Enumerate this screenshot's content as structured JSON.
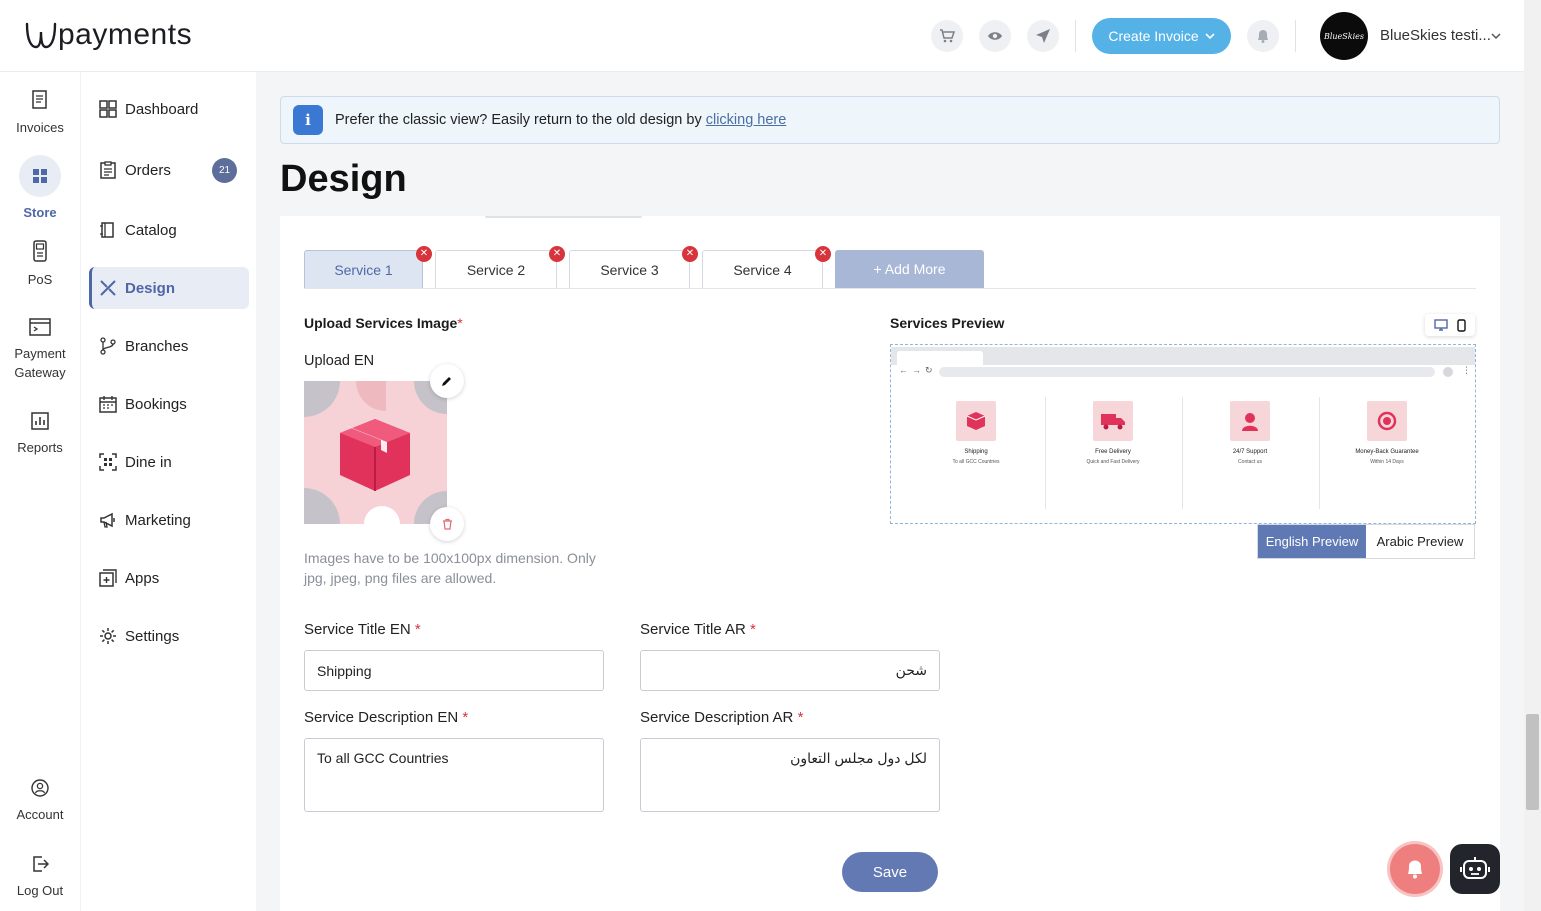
{
  "header": {
    "logo_text": "payments",
    "create_invoice_label": "Create Invoice",
    "avatar_text": "BlueSkies",
    "account_name": "BlueSkies testi..."
  },
  "rail": {
    "items": [
      {
        "label": "Invoices"
      },
      {
        "label": "Store"
      },
      {
        "label": "PoS"
      },
      {
        "label": "Payment Gateway"
      },
      {
        "label": "Reports"
      },
      {
        "label": "Account"
      },
      {
        "label": "Log Out"
      }
    ]
  },
  "sidebar": {
    "items": [
      {
        "label": "Dashboard"
      },
      {
        "label": "Orders",
        "badge": "21"
      },
      {
        "label": "Catalog"
      },
      {
        "label": "Design"
      },
      {
        "label": "Branches"
      },
      {
        "label": "Bookings"
      },
      {
        "label": "Dine in"
      },
      {
        "label": "Marketing"
      },
      {
        "label": "Apps"
      },
      {
        "label": "Settings"
      }
    ]
  },
  "banner": {
    "text": "Prefer the classic view? Easily return to the old design by ",
    "link": "clicking here",
    "icon": "i"
  },
  "page_title": "Design",
  "tabs": [
    {
      "label": "Service 1",
      "active": true
    },
    {
      "label": "Service 2"
    },
    {
      "label": "Service 3"
    },
    {
      "label": "Service 4"
    }
  ],
  "add_more_label": "+ Add More",
  "upload": {
    "section_label": "Upload Services Image",
    "required_mark": "*",
    "upload_en_label": "Upload EN",
    "hint": "Images have to be 100x100px dimension. Only jpg, jpeg, png files are allowed."
  },
  "preview": {
    "section_label": "Services Preview",
    "items": [
      {
        "title": "Shipping",
        "desc": "To all GCC Countries"
      },
      {
        "title": "Free Delivery",
        "desc": "Quick and Fast Delivery"
      },
      {
        "title": "24/7 Support",
        "desc": "Contact us"
      },
      {
        "title": "Money-Back Guarantee",
        "desc": "Within 14 Days"
      }
    ],
    "english_label": "English Preview",
    "arabic_label": "Arabic Preview"
  },
  "form": {
    "title_en_label": "Service Title EN",
    "title_en_value": "Shipping",
    "title_ar_label": "Service Title AR",
    "title_ar_value": "شحن",
    "desc_en_label": "Service Description EN",
    "desc_en_value": "To all GCC Countries",
    "desc_ar_label": "Service Description AR",
    "desc_ar_value": "لكل دول مجلس التعاون",
    "required_mark": "*"
  },
  "save_label": "Save",
  "colors": {
    "accent": "#55b2e6",
    "primary": "#6279b3",
    "danger": "#d8343c"
  }
}
